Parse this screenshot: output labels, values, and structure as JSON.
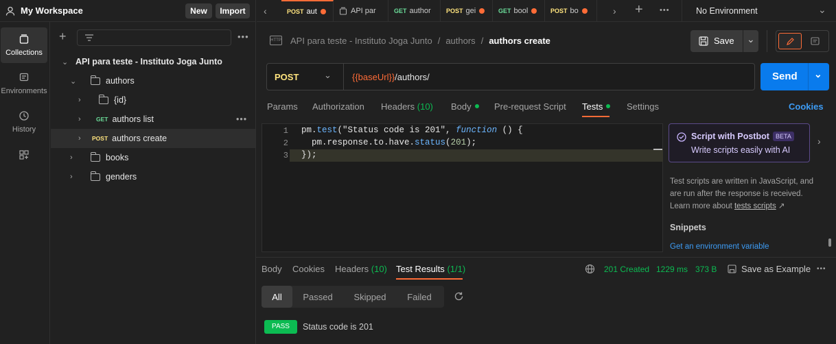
{
  "workspace": {
    "name": "My Workspace",
    "new_label": "New",
    "import_label": "Import"
  },
  "rail": [
    {
      "label": "Collections",
      "icon": "collections-icon"
    },
    {
      "label": "Environments",
      "icon": "environments-icon"
    },
    {
      "label": "History",
      "icon": "history-icon"
    }
  ],
  "tabs": [
    {
      "method": "POST",
      "label": "aut",
      "dot": true
    },
    {
      "method": "",
      "label": "API par",
      "dot": false
    },
    {
      "method": "GET",
      "label": "author",
      "dot": false
    },
    {
      "method": "POST",
      "label": "gei",
      "dot": true
    },
    {
      "method": "GET",
      "label": "bool",
      "dot": true
    },
    {
      "method": "POST",
      "label": "bo",
      "dot": true
    }
  ],
  "environment": "No Environment",
  "tree": {
    "collection": "API para teste - Instituto Joga Junto",
    "folder_authors": "authors",
    "folder_id": "{id}",
    "req_list_method": "GET",
    "req_list": "authors list",
    "req_create_method": "POST",
    "req_create": "authors create",
    "folder_books": "books",
    "folder_genders": "genders"
  },
  "breadcrumb": {
    "collection": "API para teste - Instituto Joga Junto",
    "sep": "/",
    "folder": "authors",
    "request": "authors create"
  },
  "save_label": "Save",
  "request": {
    "method": "POST",
    "url_var": "{{baseUrl}}",
    "url_path": "/authors/",
    "send_label": "Send"
  },
  "req_tabs": {
    "params": "Params",
    "auth": "Authorization",
    "headers": "Headers",
    "headers_count": "(10)",
    "body": "Body",
    "prereq": "Pre-request Script",
    "tests": "Tests",
    "settings": "Settings",
    "cookies": "Cookies"
  },
  "code": {
    "lines": [
      "1",
      "2",
      "3"
    ],
    "l1a": "pm.",
    "l1b": "test",
    "l1c": "(\"Status code is 201\", ",
    "l1d": "function",
    "l1e": " () {",
    "l2a": "  pm.response.to.have.",
    "l2b": "status",
    "l2c": "(",
    "l2d": "201",
    "l2e": ");",
    "l3": "});"
  },
  "postbot": {
    "title": "Script with Postbot",
    "badge": "BETA",
    "subtitle": "Write scripts easily with AI"
  },
  "help": {
    "text": "Test scripts are written in JavaScript, and are run after the response is received. Learn more about ",
    "link": "tests scripts",
    "arrow": "↗"
  },
  "snippets": {
    "title": "Snippets",
    "first": "Get an environment variable"
  },
  "response": {
    "body": "Body",
    "cookies": "Cookies",
    "headers": "Headers",
    "headers_count": "(10)",
    "tests": "Test Results",
    "tests_count": "(1/1)",
    "status": "201 Created",
    "time": "1229 ms",
    "size": "373 B",
    "save_example": "Save as Example"
  },
  "filters": {
    "all": "All",
    "passed": "Passed",
    "skipped": "Skipped",
    "failed": "Failed"
  },
  "result": {
    "badge": "PASS",
    "text": "Status code is 201"
  },
  "colors": {
    "accent": "#ff6c37",
    "send": "#097bed",
    "pass": "#0cbb52",
    "get": "#6bdd9a",
    "post": "#ffe47e",
    "link": "#3d9cf5"
  }
}
